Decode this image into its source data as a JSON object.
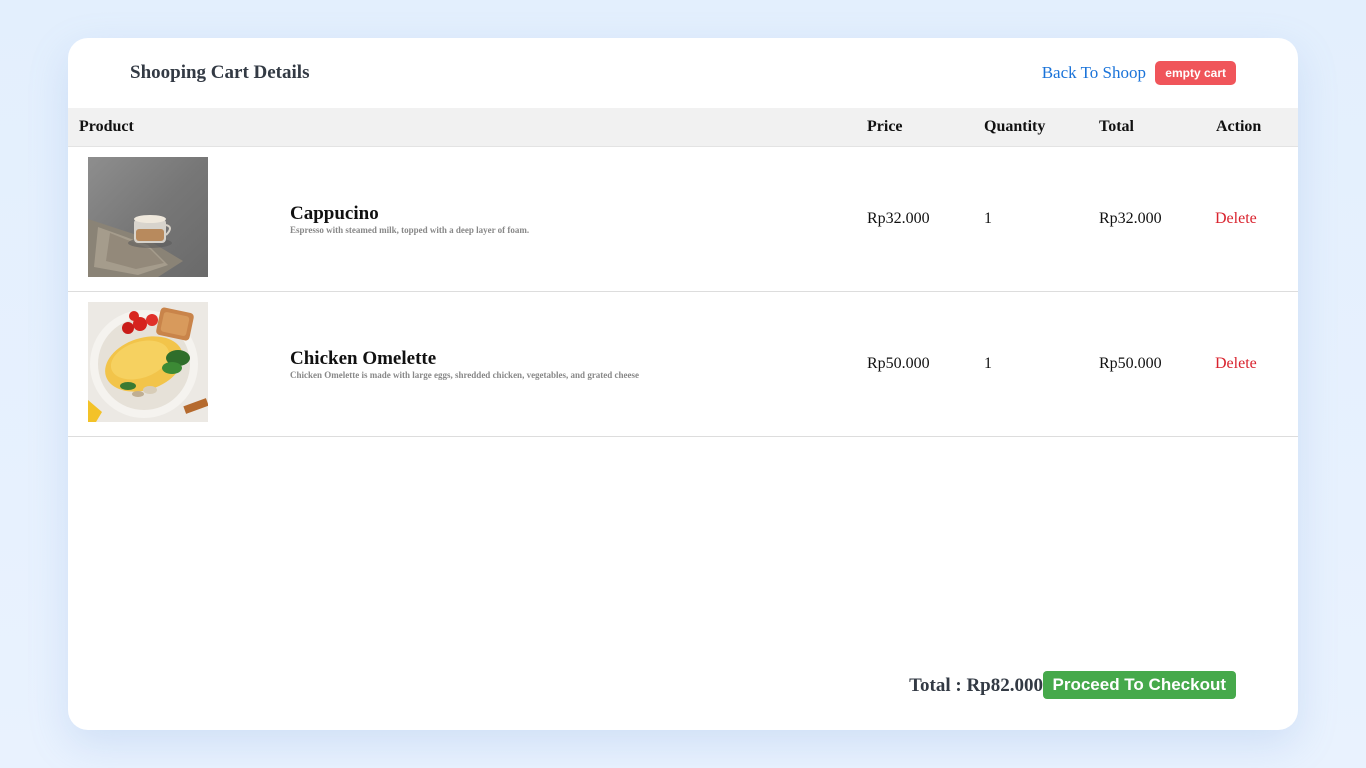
{
  "header": {
    "title": "Shooping Cart Details",
    "back_link": "Back To Shoop",
    "empty_cart": "empty cart"
  },
  "table": {
    "columns": [
      "Product",
      "Price",
      "Quantity",
      "Total",
      "Action"
    ],
    "rows": [
      {
        "name": "Cappucino",
        "description": "Espresso with steamed milk, topped with a deep layer of foam.",
        "price": "Rp32.000",
        "quantity": "1",
        "total": "Rp32.000",
        "action": "Delete"
      },
      {
        "name": "Chicken Omelette",
        "description": "Chicken Omelette is made with large eggs, shredded chicken, vegetables, and grated cheese",
        "price": "Rp50.000",
        "quantity": "1",
        "total": "Rp50.000",
        "action": "Delete"
      }
    ]
  },
  "footer": {
    "total_label": "Total : Rp82.000",
    "checkout": "Proceed To Checkout"
  },
  "colors": {
    "link": "#1a73d9",
    "danger": "#f0555a",
    "delete_text": "#d9232e",
    "success": "#46a94b"
  }
}
